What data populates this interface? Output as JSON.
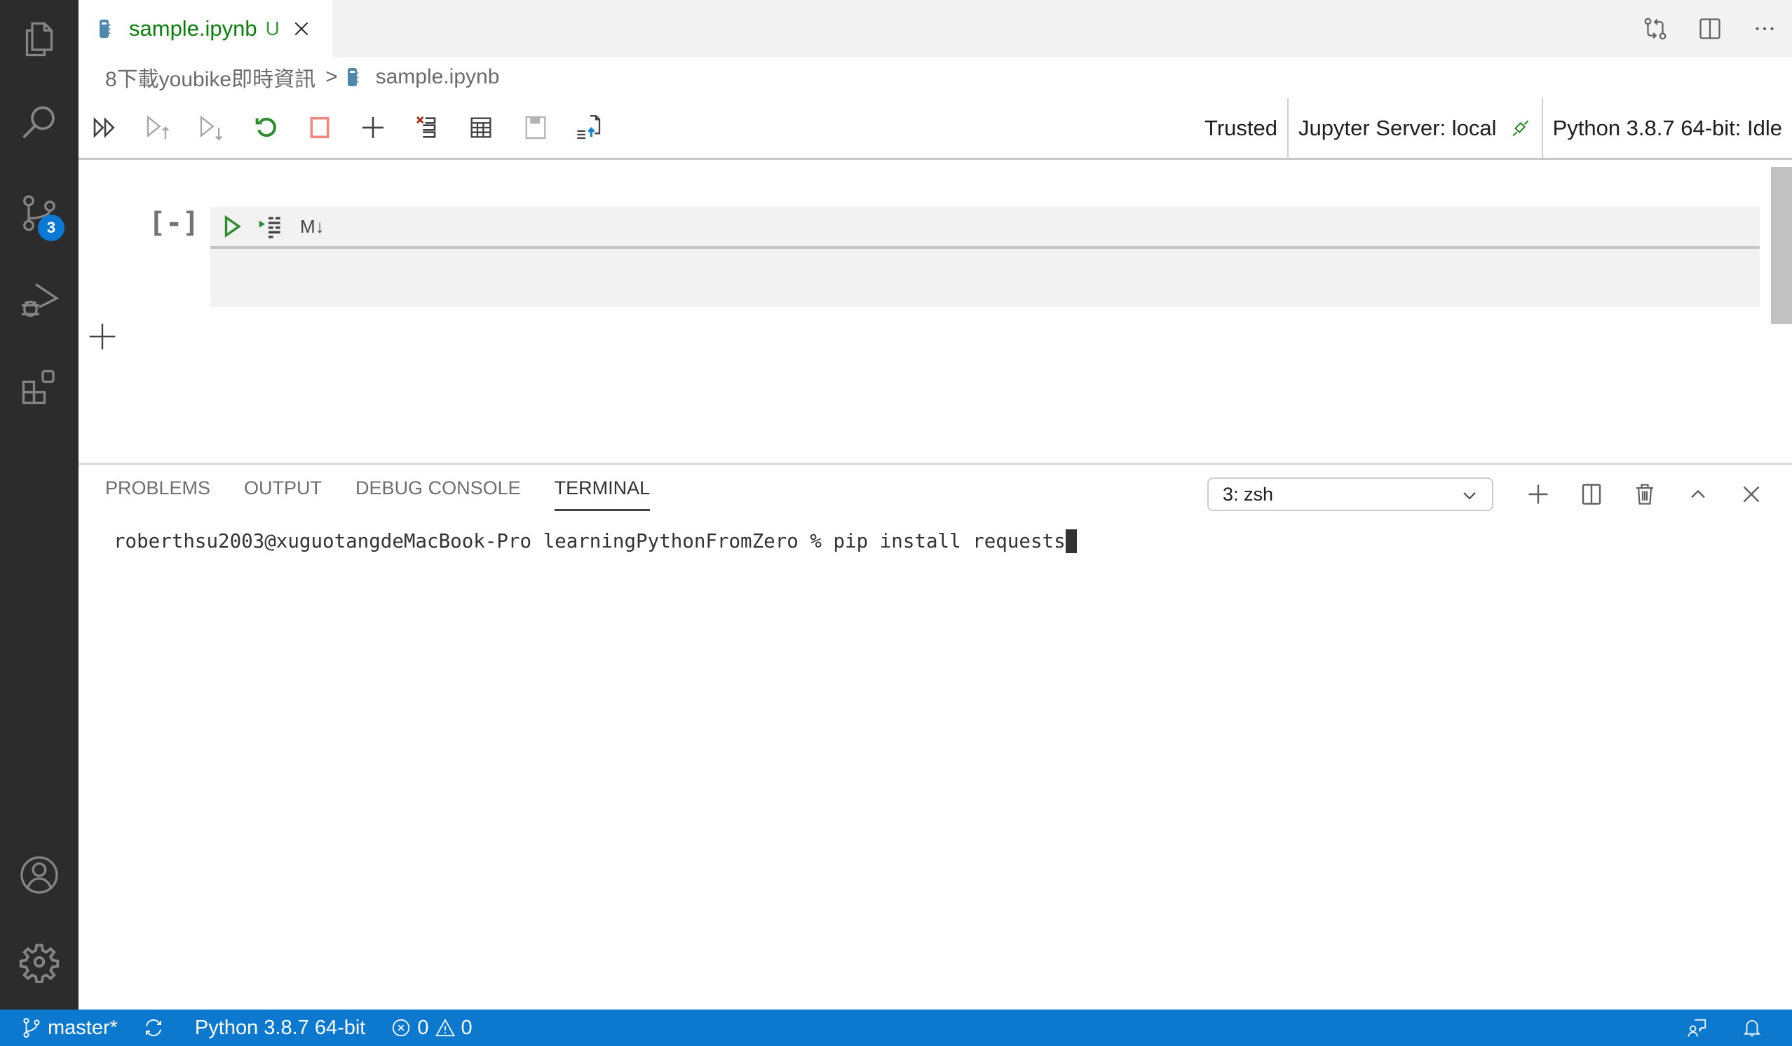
{
  "activity_bar": {
    "items": [
      {
        "name": "explorer",
        "icon": "files-icon"
      },
      {
        "name": "search",
        "icon": "search-icon"
      },
      {
        "name": "source-control",
        "icon": "source-control-icon",
        "badge": "3"
      },
      {
        "name": "run-debug",
        "icon": "run-debug-icon"
      },
      {
        "name": "extensions",
        "icon": "extensions-icon"
      }
    ],
    "bottom": [
      {
        "name": "accounts",
        "icon": "account-icon"
      },
      {
        "name": "manage",
        "icon": "gear-icon"
      }
    ]
  },
  "editor": {
    "tab": {
      "title": "sample.ipynb",
      "status": "U",
      "icon": "notebook-icon"
    },
    "tab_actions": [
      "open-changes-icon",
      "split-editor-icon",
      "more-actions-icon"
    ],
    "breadcrumb": [
      "8下載youbike即時資訊",
      "sample.ipynb"
    ],
    "breadcrumb_separator": ">"
  },
  "notebook_toolbar": {
    "buttons": [
      "run-all-icon",
      "run-above-icon",
      "run-below-icon",
      "restart-kernel-icon",
      "interrupt-kernel-icon",
      "add-cell-icon",
      "clear-outputs-icon",
      "variables-icon",
      "save-icon",
      "export-icon"
    ],
    "trusted": "Trusted",
    "server": "Jupyter Server: local",
    "kernel": "Python 3.8.7 64-bit: Idle"
  },
  "cell": {
    "execution_count": "[-]",
    "markdown_toggle": "M↓",
    "content": ""
  },
  "panel": {
    "tabs": [
      "PROBLEMS",
      "OUTPUT",
      "DEBUG CONSOLE",
      "TERMINAL"
    ],
    "active_tab": "TERMINAL",
    "terminal_select": "3: zsh",
    "terminal_line": "roberthsu2003@xuguotangdeMacBook-Pro learningPythonFromZero % pip install requests"
  },
  "status_bar": {
    "branch": "master*",
    "interpreter": "Python 3.8.7 64-bit",
    "errors": "0",
    "warnings": "0"
  },
  "colors": {
    "status_bar": "#0c79cf",
    "tab_title": "#0b7d0b",
    "badge": "#0b78d3",
    "activity_bar": "#2c2c2c"
  }
}
